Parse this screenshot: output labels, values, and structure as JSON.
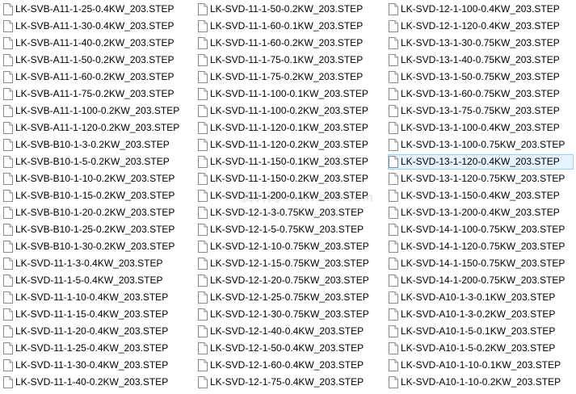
{
  "icon": "generic-file-icon",
  "colors": {
    "selection_background": "#e5f3ff",
    "selection_border": "#99d1ff",
    "text": "#000000"
  },
  "watermark_text": "资料网 www.cad.com",
  "columns": [
    {
      "files": [
        "LK-SVB-A11-1-25-0.4KW_203.STEP",
        "LK-SVB-A11-1-30-0.4KW_203.STEP",
        "LK-SVB-A11-1-40-0.2KW_203.STEP",
        "LK-SVB-A11-1-50-0.2KW_203.STEP",
        "LK-SVB-A11-1-60-0.2KW_203.STEP",
        "LK-SVB-A11-1-75-0.2KW_203.STEP",
        "LK-SVB-A11-1-100-0.2KW_203.STEP",
        "LK-SVB-A11-1-120-0.2KW_203.STEP",
        "LK-SVB-B10-1-3-0.2KW_203.STEP",
        "LK-SVB-B10-1-5-0.2KW_203.STEP",
        "LK-SVB-B10-1-10-0.2KW_203.STEP",
        "LK-SVB-B10-1-15-0.2KW_203.STEP",
        "LK-SVB-B10-1-20-0.2KW_203.STEP",
        "LK-SVB-B10-1-25-0.2KW_203.STEP",
        "LK-SVB-B10-1-30-0.2KW_203.STEP",
        "LK-SVD-11-1-3-0.4KW_203.STEP",
        "LK-SVD-11-1-5-0.4KW_203.STEP",
        "LK-SVD-11-1-10-0.4KW_203.STEP",
        "LK-SVD-11-1-15-0.4KW_203.STEP",
        "LK-SVD-11-1-20-0.4KW_203.STEP",
        "LK-SVD-11-1-25-0.4KW_203.STEP",
        "LK-SVD-11-1-30-0.4KW_203.STEP",
        "LK-SVD-11-1-40-0.2KW_203.STEP"
      ]
    },
    {
      "files": [
        "LK-SVD-11-1-50-0.2KW_203.STEP",
        "LK-SVD-11-1-60-0.1KW_203.STEP",
        "LK-SVD-11-1-60-0.2KW_203.STEP",
        "LK-SVD-11-1-75-0.1KW_203.STEP",
        "LK-SVD-11-1-75-0.2KW_203.STEP",
        "LK-SVD-11-1-100-0.1KW_203.STEP",
        "LK-SVD-11-1-100-0.2KW_203.STEP",
        "LK-SVD-11-1-120-0.1KW_203.STEP",
        "LK-SVD-11-1-120-0.2KW_203.STEP",
        "LK-SVD-11-1-150-0.1KW_203.STEP",
        "LK-SVD-11-1-150-0.2KW_203.STEP",
        "LK-SVD-11-1-200-0.1KW_203.STEP",
        "LK-SVD-12-1-3-0.75KW_203.STEP",
        "LK-SVD-12-1-5-0.75KW_203.STEP",
        "LK-SVD-12-1-10-0.75KW_203.STEP",
        "LK-SVD-12-1-15-0.75KW_203.STEP",
        "LK-SVD-12-1-20-0.75KW_203.STEP",
        "LK-SVD-12-1-25-0.75KW_203.STEP",
        "LK-SVD-12-1-30-0.75KW_203.STEP",
        "LK-SVD-12-1-40-0.4KW_203.STEP",
        "LK-SVD-12-1-50-0.4KW_203.STEP",
        "LK-SVD-12-1-60-0.4KW_203.STEP",
        "LK-SVD-12-1-75-0.4KW_203.STEP"
      ]
    },
    {
      "files": [
        "LK-SVD-12-1-100-0.4KW_203.STEP",
        "LK-SVD-12-1-120-0.4KW_203.STEP",
        "LK-SVD-13-1-30-0.75KW_203.STEP",
        "LK-SVD-13-1-40-0.75KW_203.STEP",
        "LK-SVD-13-1-50-0.75KW_203.STEP",
        "LK-SVD-13-1-60-0.75KW_203.STEP",
        "LK-SVD-13-1-75-0.75KW_203.STEP",
        "LK-SVD-13-1-100-0.4KW_203.STEP",
        "LK-SVD-13-1-100-0.75KW_203.STEP",
        "LK-SVD-13-1-120-0.4KW_203.STEP",
        "LK-SVD-13-1-120-0.75KW_203.STEP",
        "LK-SVD-13-1-150-0.4KW_203.STEP",
        "LK-SVD-13-1-200-0.4KW_203.STEP",
        "LK-SVD-14-1-100-0.75KW_203.STEP",
        "LK-SVD-14-1-120-0.75KW_203.STEP",
        "LK-SVD-14-1-150-0.75KW_203.STEP",
        "LK-SVD-14-1-200-0.75KW_203.STEP",
        "LK-SVD-A10-1-3-0.1KW_203.STEP",
        "LK-SVD-A10-1-3-0.2KW_203.STEP",
        "LK-SVD-A10-1-5-0.1KW_203.STEP",
        "LK-SVD-A10-1-5-0.2KW_203.STEP",
        "LK-SVD-A10-1-10-0.1KW_203.STEP",
        "LK-SVD-A10-1-10-0.2KW_203.STEP"
      ]
    }
  ],
  "selected": {
    "column": 2,
    "row": 9
  }
}
